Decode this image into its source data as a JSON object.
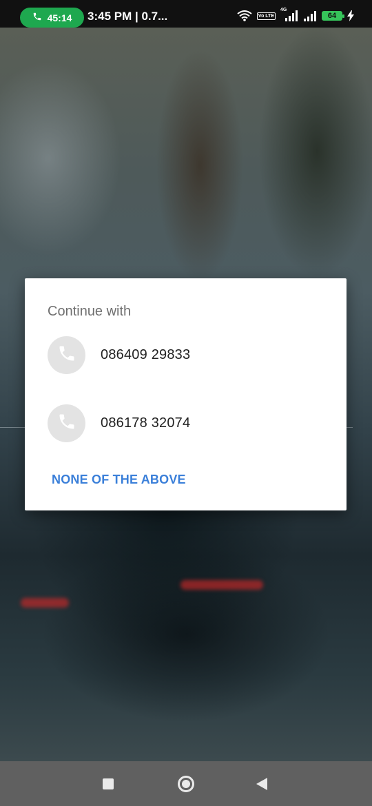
{
  "status_bar": {
    "call_timer": "45:14",
    "time": "3:45 PM | 0.7...",
    "network_type": "4G",
    "volte_label": "Vo LTE",
    "battery_level": "64",
    "icons": [
      "phone-icon",
      "wifi-icon",
      "volte-icon",
      "signal-icon",
      "signal-icon-2",
      "battery-icon",
      "charging-icon"
    ]
  },
  "dialog": {
    "title": "Continue with",
    "accounts": [
      {
        "icon": "phone-icon",
        "number": "086409 29833"
      },
      {
        "icon": "phone-icon",
        "number": "086178 32074"
      }
    ],
    "none_button_label": "NONE OF THE ABOVE"
  },
  "colors": {
    "accent": "#3a7fd9",
    "call_pill": "#1ea84f",
    "battery": "#36c45a"
  },
  "nav_bar": {
    "buttons": [
      "recents-button",
      "home-button",
      "back-button"
    ]
  }
}
